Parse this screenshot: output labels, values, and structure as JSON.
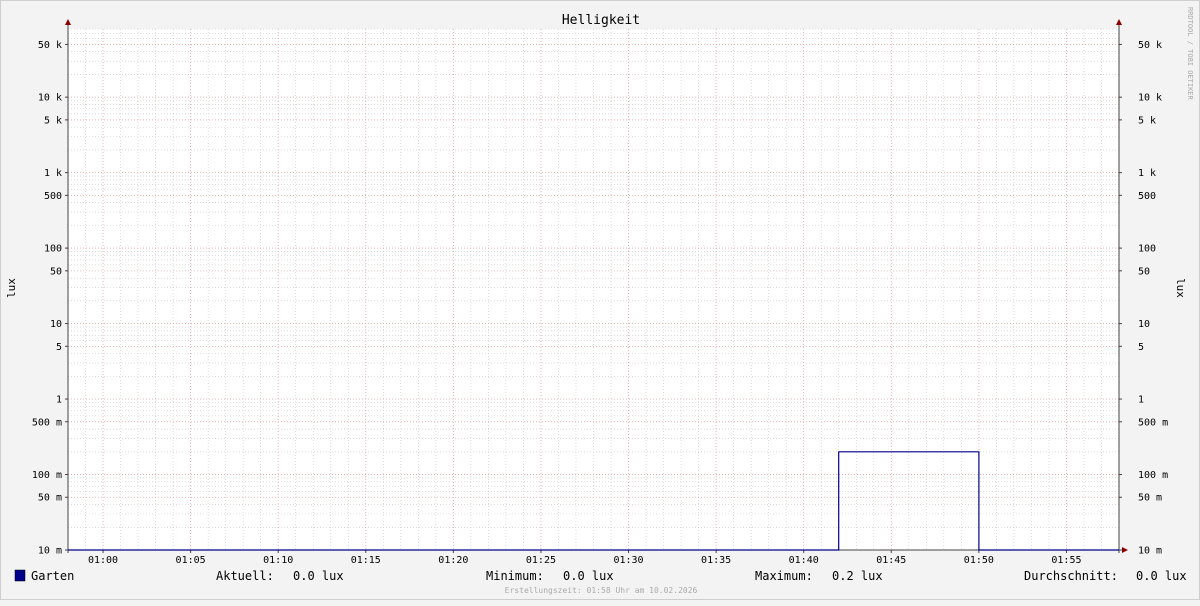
{
  "chart_data": {
    "type": "line",
    "title": "Helligkeit",
    "ylabel_left": "lux",
    "ylabel_right": "lux",
    "y_scale": "log",
    "ylim": [
      0.01,
      80000
    ],
    "xlim": [
      "00:58",
      "01:58"
    ],
    "x_ticks": [
      "01:00",
      "01:05",
      "01:10",
      "01:15",
      "01:20",
      "01:25",
      "01:30",
      "01:35",
      "01:40",
      "01:45",
      "01:50",
      "01:55"
    ],
    "y_ticks": [
      {
        "value": 50000,
        "label": "50 k"
      },
      {
        "value": 10000,
        "label": "10 k"
      },
      {
        "value": 5000,
        "label": "5 k"
      },
      {
        "value": 1000,
        "label": "1 k"
      },
      {
        "value": 500,
        "label": "500"
      },
      {
        "value": 100,
        "label": "100"
      },
      {
        "value": 50,
        "label": "50"
      },
      {
        "value": 10,
        "label": "10"
      },
      {
        "value": 5,
        "label": "5"
      },
      {
        "value": 1,
        "label": "1"
      },
      {
        "value": 0.5,
        "label": "500 m"
      },
      {
        "value": 0.1,
        "label": "100 m"
      },
      {
        "value": 0.05,
        "label": "50 m"
      },
      {
        "value": 0.01,
        "label": "10 m"
      }
    ],
    "series": [
      {
        "name": "Garten",
        "color": "#00008b",
        "points": [
          {
            "t": "00:58",
            "v": 0.0
          },
          {
            "t": "01:42",
            "v": 0.0
          },
          {
            "t": "01:42",
            "v": 0.2
          },
          {
            "t": "01:50",
            "v": 0.2
          },
          {
            "t": "01:50",
            "v": 0.0
          },
          {
            "t": "01:58",
            "v": 0.0
          }
        ]
      }
    ],
    "grid": true,
    "legend_placement": "bottom"
  },
  "legend": {
    "series_name": "Garten",
    "series_color": "#00008b",
    "stats": [
      {
        "label": "Aktuell:",
        "value": "0.0 lux"
      },
      {
        "label": "Minimum:",
        "value": "0.0 lux"
      },
      {
        "label": "Maximum:",
        "value": "0.2 lux"
      },
      {
        "label": "Durchschnitt:",
        "value": "0.0 lux"
      }
    ]
  },
  "watermark": "RRDTOOL / TOBI OETIKER",
  "footer": "Erstellungszeit: 01:58 Uhr am 10.02.2026",
  "colors": {
    "major_grid": "#e8a0a0",
    "minor_grid": "#c8c8c8",
    "axis": "#444444",
    "arrow": "#8b0000",
    "plot_bg": "#ffffff"
  }
}
